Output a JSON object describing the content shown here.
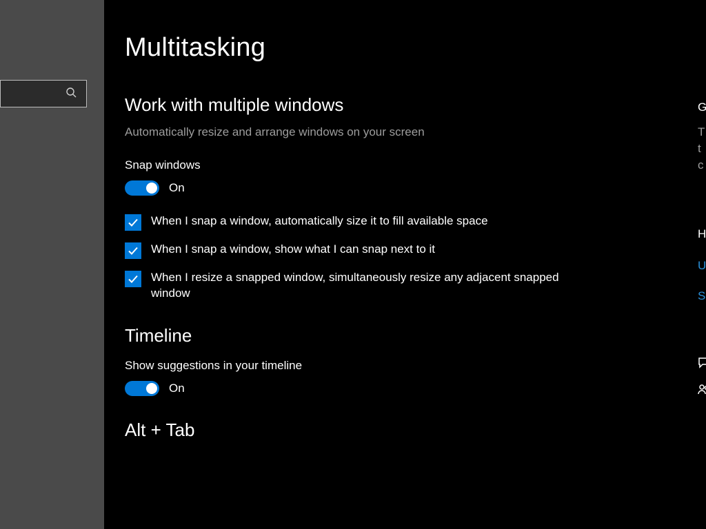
{
  "page": {
    "title": "Multitasking"
  },
  "section1": {
    "heading": "Work with multiple windows",
    "sub": "Automatically resize and arrange windows on your screen",
    "snap_label": "Snap windows",
    "snap_state": "On",
    "checks": [
      "When I snap a window, automatically size it to fill available space",
      "When I snap a window, show what I can snap next to it",
      "When I resize a snapped window, simultaneously resize any adjacent snapped window"
    ]
  },
  "section2": {
    "heading": "Timeline",
    "sugg_label": "Show suggestions in your timeline",
    "sugg_state": "On"
  },
  "section3": {
    "heading": "Alt + Tab"
  },
  "right": {
    "a": "G",
    "b": "T",
    "c": "t",
    "d": "c",
    "e": "H",
    "f": "U",
    "g": "S"
  }
}
